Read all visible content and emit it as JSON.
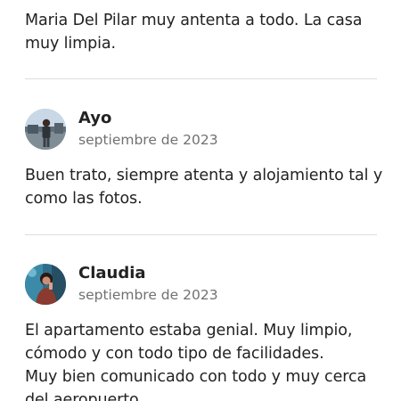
{
  "previous_review": {
    "lines": [
      "Maria Del Pilar muy antenta a todo. La casa",
      "muy limpia."
    ]
  },
  "reviews": [
    {
      "name": "Ayo",
      "date": "septiembre de 2023",
      "avatar_icon": "person-photo",
      "lines": [
        "Buen trato, siempre atenta y alojamiento tal y",
        "como las fotos."
      ]
    },
    {
      "name": "Claudia",
      "date": "septiembre de 2023",
      "avatar_icon": "person-photo",
      "lines": [
        "El apartamento estaba genial. Muy limpio,",
        "cómodo y con todo tipo de facilidades.",
        "Muy bien comunicado con todo y muy cerca",
        "del aeropuerto."
      ]
    }
  ],
  "colors": {
    "text": "#222222",
    "secondary_text": "#717171",
    "divider": "#dddddd",
    "background": "#ffffff"
  }
}
